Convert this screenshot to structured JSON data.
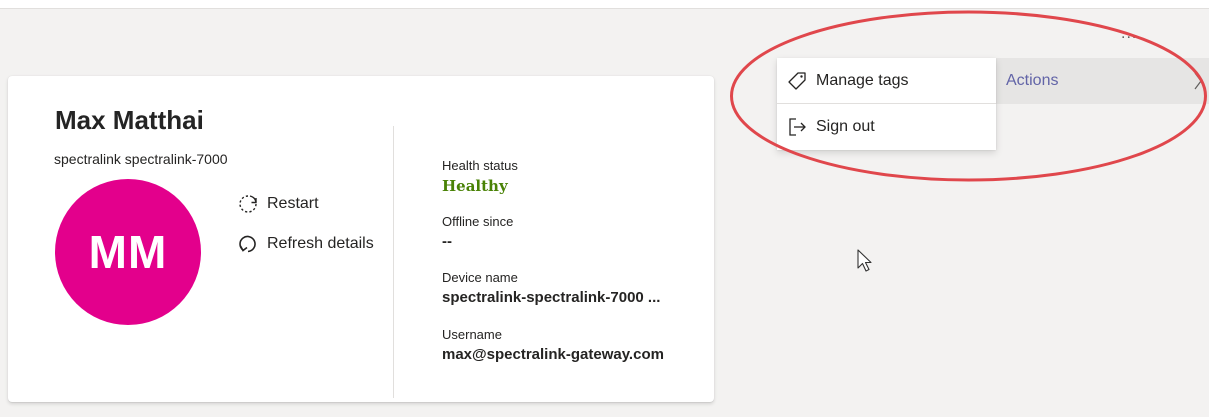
{
  "device": {
    "display_name": "Max Matthai",
    "model": "spectralink spectralink-7000",
    "avatar_initials": "MM",
    "avatar_color": "#e3008c"
  },
  "actions": {
    "restart_label": "Restart",
    "refresh_label": "Refresh details"
  },
  "details": [
    {
      "label": "Health status",
      "value": "Healthy"
    },
    {
      "label": "Offline since",
      "value": "--"
    },
    {
      "label": "Device name",
      "value": "spectralink-spectralink-7000 ..."
    },
    {
      "label": "Username",
      "value": "max@spectralink-gateway.com"
    }
  ],
  "toolbar": {
    "more_label": "...",
    "actions_label": "Actions"
  },
  "menu": {
    "items": [
      {
        "label": "Manage tags",
        "icon": "tag-icon"
      },
      {
        "label": "Sign out",
        "icon": "sign-out-icon"
      }
    ]
  },
  "colors": {
    "accent": "#6264a7",
    "healthy": "#498205",
    "annotation": "#e0474c"
  }
}
